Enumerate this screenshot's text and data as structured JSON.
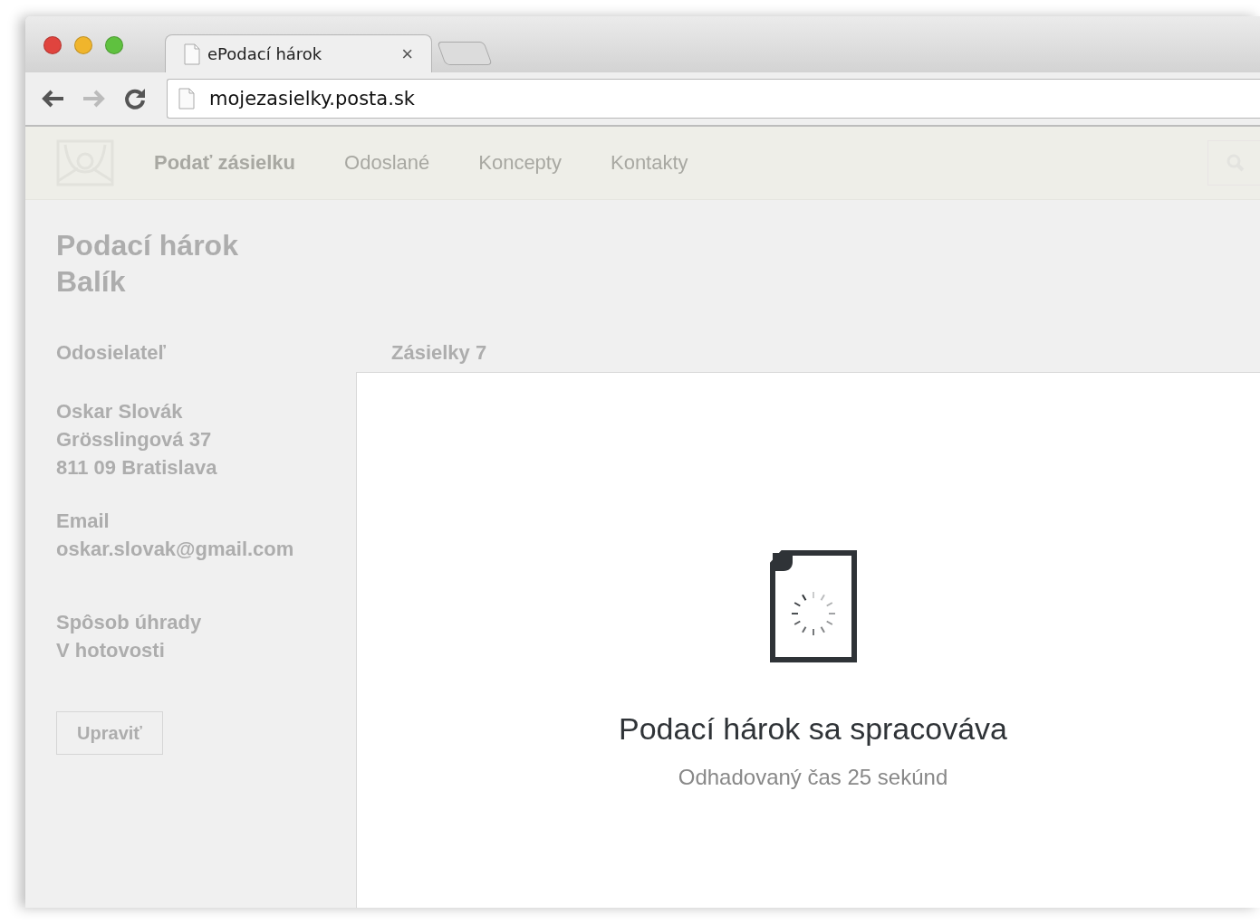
{
  "browser": {
    "tab": {
      "title": "ePodací hárok",
      "close": "×"
    },
    "address": "mojezasielky.posta.sk"
  },
  "nav": {
    "items": [
      {
        "label": "Podať zásielku"
      },
      {
        "label": "Odoslané"
      },
      {
        "label": "Koncepty"
      },
      {
        "label": "Kontakty"
      }
    ]
  },
  "page": {
    "title": "Podací hárok",
    "subtitle": "Balík"
  },
  "sender": {
    "heading": "Odosielateľ",
    "address_lines": [
      "Oskar Slovák",
      "Grösslingová 37",
      "811 09 Bratislava"
    ],
    "email_label": "Email",
    "email": "oskar.slovak@gmail.com",
    "payment_label": "Spôsob úhrady",
    "payment": "V hotovosti",
    "edit_button": "Upraviť"
  },
  "shipments": {
    "heading": "Zásielky 7"
  },
  "processing": {
    "title": "Podací hárok sa spracováva",
    "subtitle": "Odhadovaný čas 25 sekúnd"
  }
}
